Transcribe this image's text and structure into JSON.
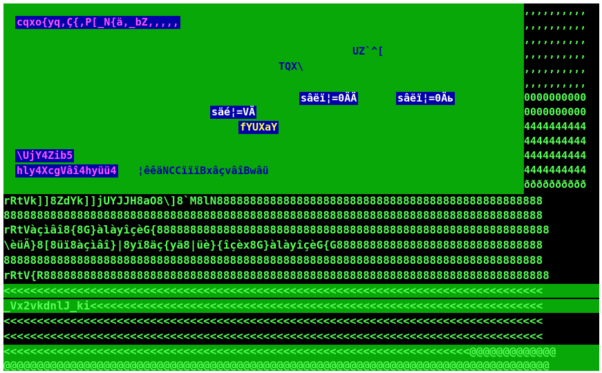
{
  "title_line": "cqxo{yq,Ç{,P[_N{ä,_bZ,,,,,",
  "labels": {
    "uz": "UZ`^[",
    "tqx": "TQX\\",
    "sa1": "sâëï¦=0ÄÄ",
    "sa2": "sâëï¦=0Äь",
    "sae": "säé¦=VÄ",
    "fyux": "fYUXaY",
    "nuj": "\\UjY4Zib5",
    "hly": "hly4XcgVâî4hyüü4",
    "hly_tail": "¦êêäNCCïïïBxâçvâîBwâü"
  },
  "right_column": [
    ",,,,,,,,,,",
    ",,,,,,,,,,",
    ",,,,,,,,,,",
    ",,,,,,,,,,",
    ",,,,,,,,,,",
    ",,,,,,,,,,",
    "0000000000",
    "0000000000",
    "4444444444",
    "4444444444",
    "4444444444",
    "4444444444",
    "ðððððððððð"
  ],
  "rows": [
    "rRtVk]]8ZdYk]]jUYJJH8aO8\\]8`M8lN8888888888888888888888888888888888888888888888888",
    "888888888888888888888888888888888888888888888888888888888888888888888888888888888",
    "rRtVàçìâî8{8G}àlàyîçèG{88888888888888888888888888888888888888888888888888888888888",
    "\\èüÄ}8[8üï8àçìâî}|8yï8äç{yä8|üè}{îçèx8G}àlàyîçèG{G8888888888888888888888888888888",
    "888888888888888888888888888888888888888888888888888888888888888888888888888888888",
    "rRtV{R8888888888888888888888888888888888888888888888888888888888888888888888888888",
    "<<<<<<<<<<<<<<<<<<<<<<<<<<<<<<<<<<<<<<<<<<<<<<<<<<<<<<<<<<<<<<<<<<<<<<<<<<<<<<<<<",
    "_Vx2vkdnlJ_ki<<<<<<<<<<<<<<<<<<<<<<<<<<<<<<<<<<<<<<<<<<<<<<<<<<<<<<<<<<<<<<<<<<<<",
    "<<<<<<<<<<<<<<<<<<<<<<<<<<<<<<<<<<<<<<<<<<<<<<<<<<<<<<<<<<<<<<<<<<<<<<<<<<<<<<<<<",
    "<<<<<<<<<<<<<<<<<<<<<<<<<<<<<<<<<<<<<<<<<<<<<<<<<<<<<<<<<<<<<<<<<<<<<<<<<<<<<<<<<",
    "<<<<<<<<<<<<<<<<<<<<<<<<<<<<<<<<<<<<<<<<<<<<<<<<<<<<<<<<<<<<<<<<<<<<<<@@@@@@@@@@@@@",
    "@@@@@@@@@@@@@@@@@@@@@@@@@@@@@@@@@@@@@@@@@@@@@@@@@@@@@@@@@@@@@@@@@@@@@@@@@@@@@@@@@@"
  ],
  "colors": {
    "green_bg": "#08a808",
    "bright_green": "#55ff55",
    "navy": "#0000a8",
    "magenta": "#ff55ff",
    "yellow": "#ffff55"
  }
}
